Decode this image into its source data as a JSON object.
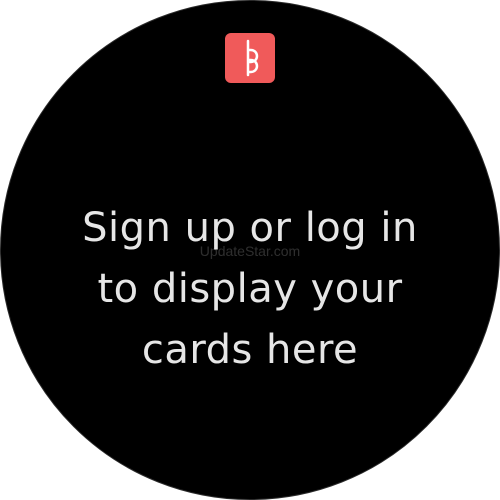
{
  "app_logo": {
    "icon": "b-p-logo-icon",
    "background_color": "#f05a5a"
  },
  "message": {
    "line1": "Sign up or log in",
    "line2": "to display your",
    "line3": "cards here"
  },
  "watermark": "UpdateStar.com",
  "colors": {
    "face": "#000000",
    "text": "#e6e6e6"
  }
}
